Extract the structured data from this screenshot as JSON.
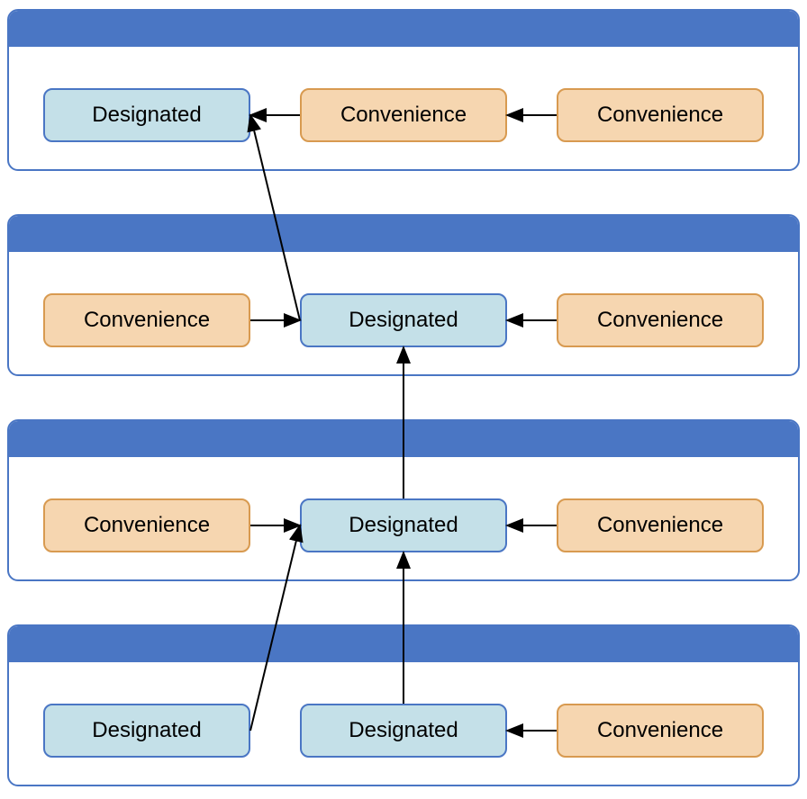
{
  "labels": {
    "designated": "Designated",
    "convenience": "Convenience"
  },
  "colors": {
    "containerBorder": "#4a76c4",
    "headerBg": "#4a76c4",
    "designatedBg": "#c4e0e8",
    "designatedBorder": "#4a76c4",
    "convenienceBg": "#f6d6b0",
    "convenienceBorder": "#d89a50"
  },
  "diagram": {
    "rows": [
      {
        "boxes": [
          "designated",
          "convenience",
          "convenience"
        ]
      },
      {
        "boxes": [
          "convenience",
          "designated",
          "convenience"
        ]
      },
      {
        "boxes": [
          "convenience",
          "designated",
          "convenience"
        ]
      },
      {
        "boxes": [
          "designated",
          "designated",
          "convenience"
        ]
      }
    ],
    "edges": [
      {
        "from": "r0b1",
        "to": "r0b0"
      },
      {
        "from": "r0b2",
        "to": "r0b1"
      },
      {
        "from": "r1b0",
        "to": "r1b1"
      },
      {
        "from": "r1b2",
        "to": "r1b1"
      },
      {
        "from": "r1b1",
        "to": "r0b0"
      },
      {
        "from": "r2b0",
        "to": "r2b1"
      },
      {
        "from": "r2b2",
        "to": "r2b1"
      },
      {
        "from": "r2b1",
        "to": "r1b1"
      },
      {
        "from": "r3b2",
        "to": "r3b1"
      },
      {
        "from": "r3b0",
        "to": "r2b1"
      },
      {
        "from": "r3b1",
        "to": "r2b1"
      }
    ]
  }
}
